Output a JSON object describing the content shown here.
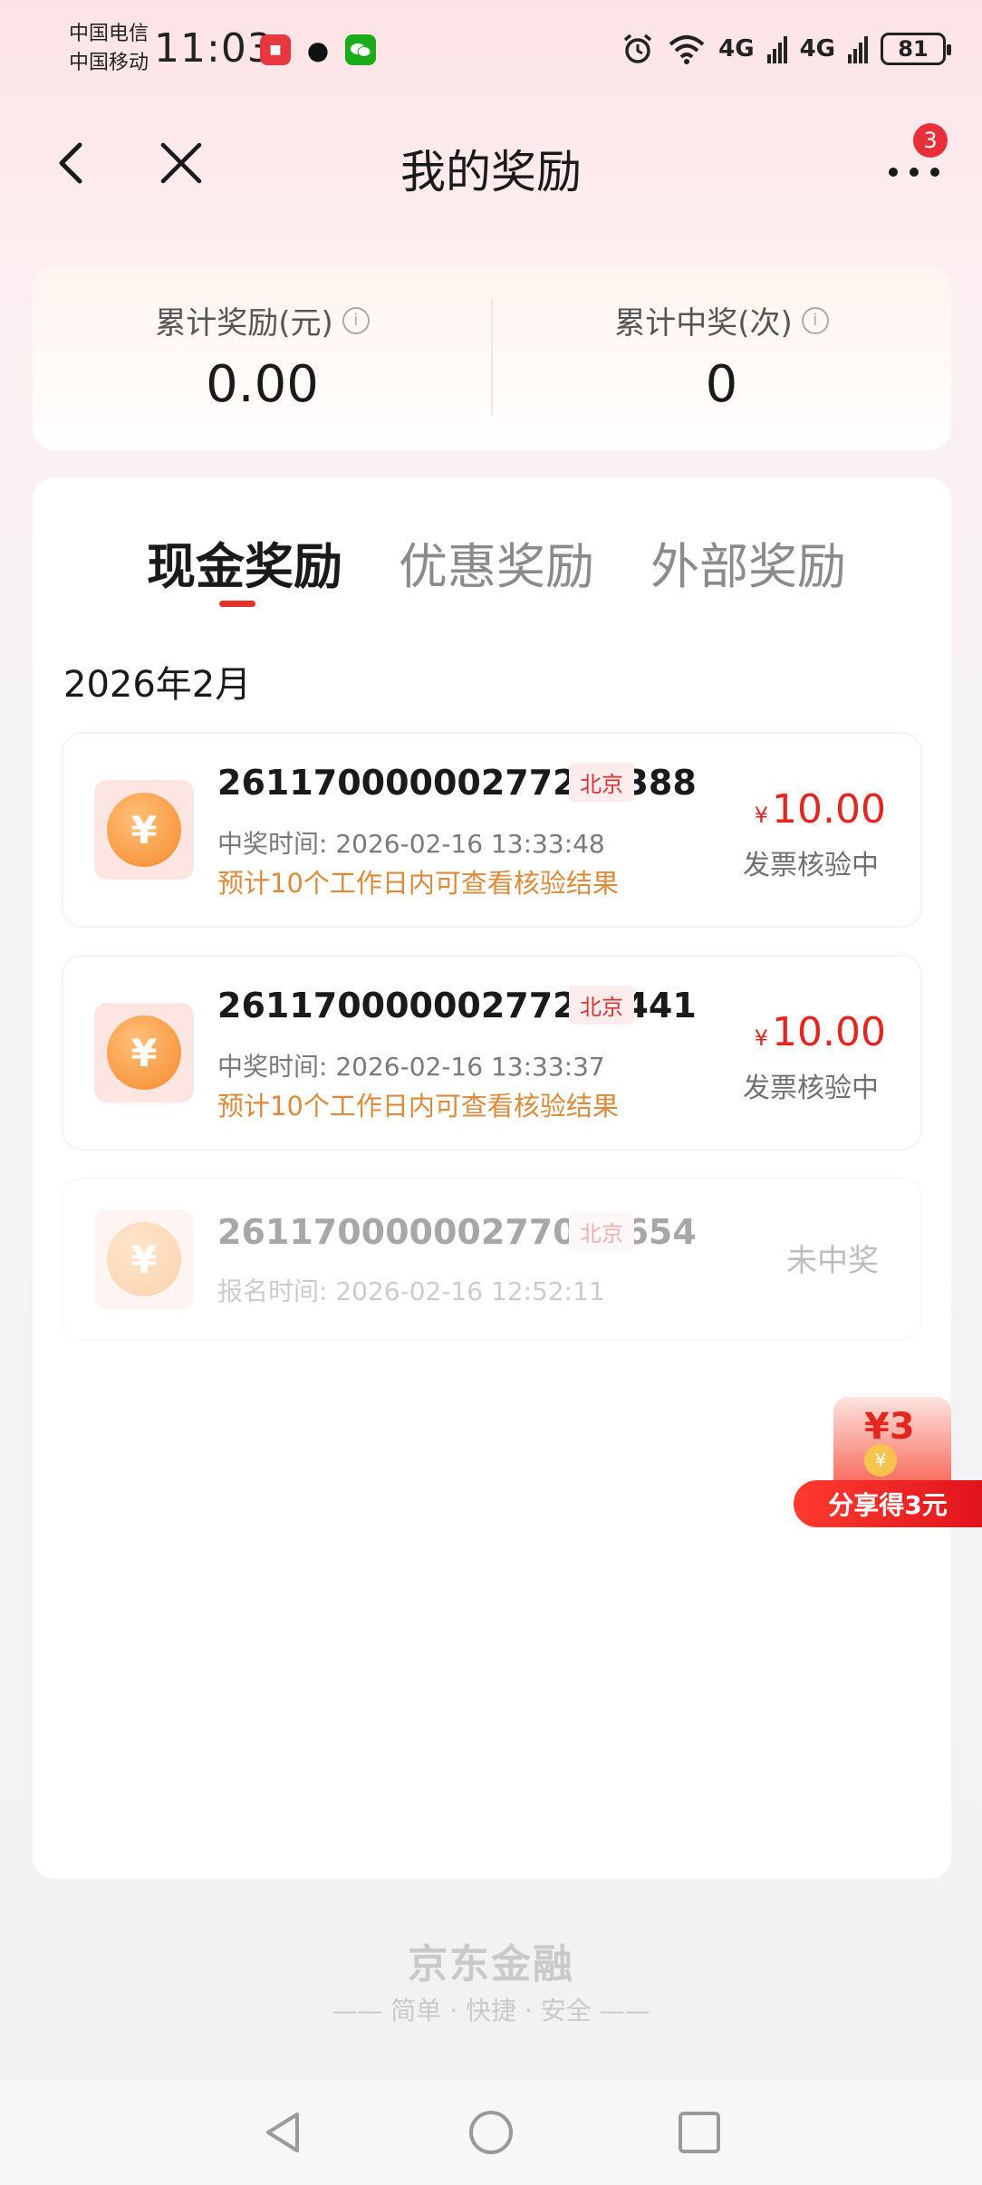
{
  "status_bar": {
    "carrier_1": "中国电信",
    "carrier_2": "中国移动",
    "time": "11:03",
    "network_1": "4G",
    "network_2": "4G",
    "battery": "81",
    "icons": [
      "huawei-app-icon",
      "qq-icon",
      "wechat-icon",
      "alarm-icon",
      "wifi-icon",
      "signal-icon",
      "battery-icon"
    ]
  },
  "nav": {
    "title": "我的奖励",
    "more_badge": "3"
  },
  "summary": {
    "total_reward_label": "累计奖励(元)",
    "total_reward_value": "0.00",
    "total_wins_label": "累计中奖(次)",
    "total_wins_value": "0"
  },
  "tabs": [
    {
      "label": "现金奖励",
      "active": true
    },
    {
      "label": "优惠奖励",
      "active": false
    },
    {
      "label": "外部奖励",
      "active": false
    }
  ],
  "month": "2026年2月",
  "rewards": [
    {
      "id": "26117000000277256388",
      "tag": "北京",
      "time": "中奖时间:  2026-02-16 13:33:48",
      "note": "预计10个工作日内可查看核验结果",
      "currency": "¥",
      "amount": "10.00",
      "status": "发票核验中"
    },
    {
      "id": "26117000000277256441",
      "tag": "北京",
      "time": "中奖时间:  2026-02-16 13:33:37",
      "note": "预计10个工作日内可查看核验结果",
      "currency": "¥",
      "amount": "10.00",
      "status": "发票核验中"
    },
    {
      "id": "26117000000277006654",
      "tag": "北京",
      "time": "报名时间:  2026-02-16 12:52:11",
      "status": "未中奖"
    }
  ],
  "share": {
    "envelope_value": "¥3",
    "label": "分享得3元"
  },
  "footer": {
    "brand": "京东金融",
    "slogan": "—— 简单 · 快捷 · 安全 ——"
  },
  "colors": {
    "accent_red": "#e3261f",
    "note_orange": "#dc8a3c"
  }
}
